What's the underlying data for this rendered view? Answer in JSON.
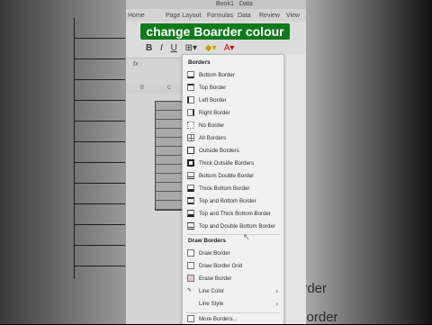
{
  "app": {
    "title_fragment": "Book1",
    "search_fragment": "Data"
  },
  "ribbon_tabs": [
    "Home",
    "Page Layout",
    "Formulas",
    "Data",
    "Review",
    "View"
  ],
  "banner": {
    "text": "change Boarder colour",
    "color": "#0f7a1b"
  },
  "font_buttons": [
    "B",
    "I",
    "U"
  ],
  "columns": [
    "B",
    "C"
  ],
  "formula_label": "fx",
  "borders_menu": {
    "section_borders": "Borders",
    "borders": [
      "Bottom Border",
      "Top Border",
      "Left Border",
      "Right Border",
      "No Border",
      "All Borders",
      "Outside Borders",
      "Thick Outside Borders",
      "Bottom Double Border",
      "Thick Bottom Border",
      "Top and Bottom Border",
      "Top and Thick Bottom Border",
      "Top and Double Bottom Border"
    ],
    "section_draw": "Draw Borders",
    "draw": [
      "Draw Border",
      "Draw Border Grid",
      "Erase Border"
    ],
    "line_color": "Line Color",
    "line_style": "Line Style",
    "more": "More Borders..."
  },
  "background_right": [
    "Border",
    "n Border"
  ]
}
